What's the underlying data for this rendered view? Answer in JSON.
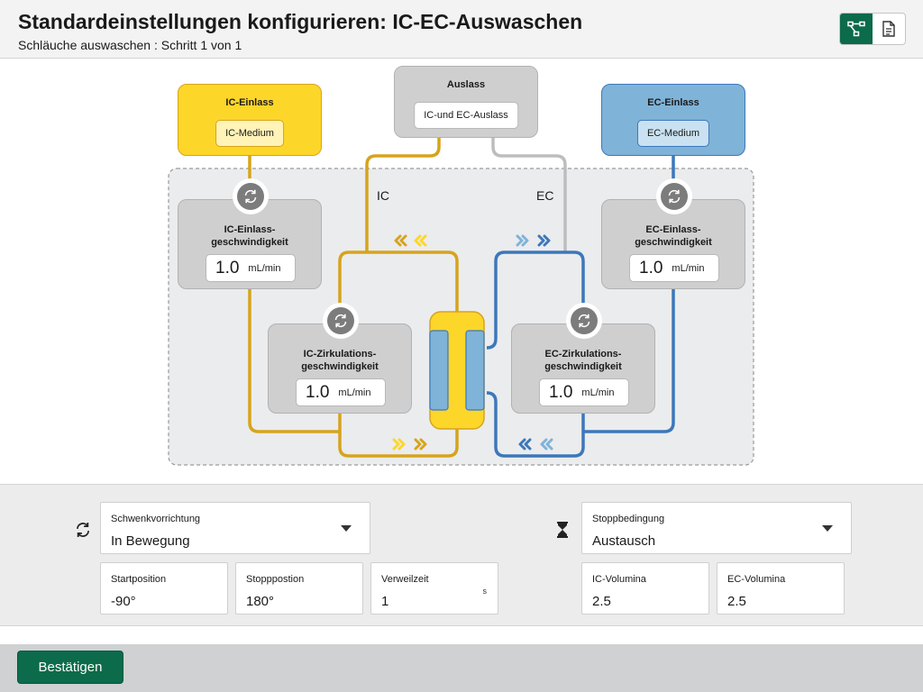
{
  "header": {
    "title": "Standardeinstellungen konfigurieren: IC-EC-Auswaschen",
    "subtitle": "Schläuche auswaschen : Schritt 1 von 1",
    "views": [
      {
        "icon": "diagram-view-icon",
        "active": true
      },
      {
        "icon": "document-view-icon",
        "active": false
      }
    ]
  },
  "diagram": {
    "ic_inlet": {
      "title": "IC-Einlass",
      "medium": "IC-Medium"
    },
    "outlet": {
      "title": "Auslass",
      "medium": "IC-und EC-Auslass"
    },
    "ec_inlet": {
      "title": "EC-Einlass",
      "medium": "EC-Medium"
    },
    "label_ic": "IC",
    "label_ec": "EC",
    "pumps": {
      "ic_inlet_rate": {
        "label_line1": "IC-Einlass-",
        "label_line2": "geschwindigkeit",
        "value": "1.0",
        "unit": "mL/min"
      },
      "ec_inlet_rate": {
        "label_line1": "EC-Einlass-",
        "label_line2": "geschwindigkeit",
        "value": "1.0",
        "unit": "mL/min"
      },
      "ic_circ_rate": {
        "label_line1": "IC-Zirkulations-",
        "label_line2": "geschwindigkeit",
        "value": "1.0",
        "unit": "mL/min"
      },
      "ec_circ_rate": {
        "label_line1": "EC-Zirkulations-",
        "label_line2": "geschwindigkeit",
        "value": "1.0",
        "unit": "mL/min"
      }
    },
    "colors": {
      "ic": "#d6a41c",
      "ec": "#3c78ba",
      "outlet": "#bdbdbd",
      "ic_fill": "#fdd62a",
      "ec_fill": "#7fb3d8"
    }
  },
  "controls": {
    "rocker": {
      "label": "Schwenkvorrichtung",
      "value": "In Bewegung",
      "icon": "rotate-icon"
    },
    "start_position": {
      "label": "Startposition",
      "value": "-90°"
    },
    "stop_position": {
      "label": "Stopppostion",
      "value": "180°"
    },
    "dwell_time": {
      "label": "Verweilzeit",
      "value": "1",
      "unit": "s"
    },
    "stop_condition": {
      "label": "Stoppbedingung",
      "value": "Austausch",
      "icon": "hourglass-icon"
    },
    "ic_volumes": {
      "label": "IC-Volumina",
      "value": "2.5"
    },
    "ec_volumes": {
      "label": "EC-Volumina",
      "value": "2.5"
    }
  },
  "footer": {
    "confirm_label": "Bestätigen"
  }
}
